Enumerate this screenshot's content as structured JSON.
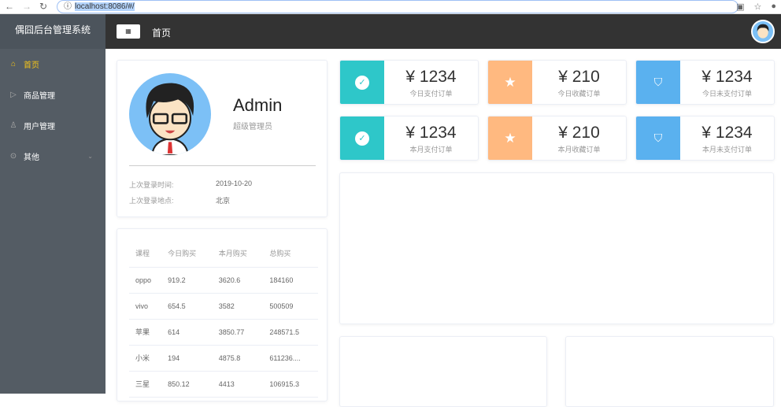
{
  "browser": {
    "url": "localhost:8086/#/"
  },
  "app": {
    "title": "偶囧后台管理系统"
  },
  "sidebar": {
    "items": [
      {
        "label": "首页",
        "icon": "home-icon"
      },
      {
        "label": "商品管理",
        "icon": "play-circle-icon"
      },
      {
        "label": "用户管理",
        "icon": "user-icon"
      },
      {
        "label": "其他",
        "icon": "location-icon"
      }
    ]
  },
  "header": {
    "breadcrumb": "首页"
  },
  "profile": {
    "name": "Admin",
    "role": "超级管理员",
    "last_login_time_label": "上次登录时间:",
    "last_login_time": "2019-10-20",
    "last_login_place_label": "上次登录地点:",
    "last_login_place": "北京"
  },
  "table": {
    "headers": [
      "课程",
      "今日购买",
      "本月购买",
      "总购买"
    ],
    "rows": [
      [
        "oppo",
        "919.2",
        "3620.6",
        "184160"
      ],
      [
        "vivo",
        "654.5",
        "3582",
        "500509"
      ],
      [
        "苹果",
        "614",
        "3850.77",
        "248571.5"
      ],
      [
        "小米",
        "194",
        "4875.8",
        "611236...."
      ],
      [
        "三星",
        "850.12",
        "4413",
        "106915.3"
      ]
    ]
  },
  "stats": [
    {
      "value": "¥ 1234",
      "label": "今日支付订单",
      "color": "#2ec7c9",
      "icon": "check-circle-icon"
    },
    {
      "value": "¥ 210",
      "label": "今日收藏订单",
      "color": "#ffb980",
      "icon": "star-icon"
    },
    {
      "value": "¥ 1234",
      "label": "今日未支付订单",
      "color": "#5ab1ef",
      "icon": "shopping-bag-icon"
    },
    {
      "value": "¥ 1234",
      "label": "本月支付订单",
      "color": "#2ec7c9",
      "icon": "check-circle-icon"
    },
    {
      "value": "¥ 210",
      "label": "本月收藏订单",
      "color": "#ffb980",
      "icon": "star-icon"
    },
    {
      "value": "¥ 1234",
      "label": "本月未支付订单",
      "color": "#5ab1ef",
      "icon": "shopping-bag-icon"
    }
  ]
}
